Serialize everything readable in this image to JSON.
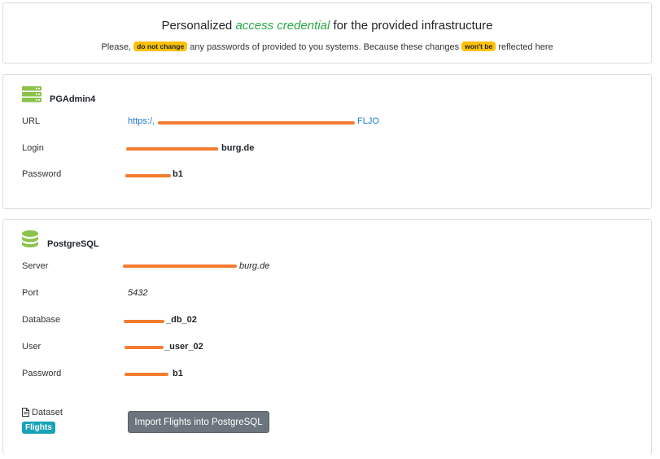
{
  "header": {
    "title_pre": "Personalized",
    "title_accent": "access credential",
    "title_post": "for the provided infrastructure",
    "note_pre": "Please,",
    "note_tag1": "do not change",
    "note_mid": "any passwords of provided to you systems. Because these changes",
    "note_tag2": "won't be",
    "note_post": "reflected here"
  },
  "pgadmin": {
    "icon": "server-icon",
    "title": "PGAdmin4",
    "url_label": "URL",
    "url_prefix": "https:/,",
    "url_suffix": "FLJO",
    "login_label": "Login",
    "login_value": "burg.de",
    "password_label": "Password",
    "password_value": "b1"
  },
  "postgres": {
    "icon": "database-icon",
    "title": "PostgreSQL",
    "server_label": "Server",
    "server_value": "burg.de",
    "port_label": "Port",
    "port_value": "5432",
    "database_label": "Database",
    "database_value": "_db_02",
    "user_label": "User",
    "user_value": "_user_02",
    "password_label": "Password",
    "password_value": "b1",
    "dataset_label": "Dataset",
    "dataset_badge": "Flights",
    "import_button": "Import Flights into PostgreSQL"
  },
  "colors": {
    "accent": "#28a745",
    "warning": "#ffc107",
    "link": "#1f7acc",
    "redaction": "#f47c30",
    "badge": "#17a2b8",
    "button": "#6c757d"
  }
}
